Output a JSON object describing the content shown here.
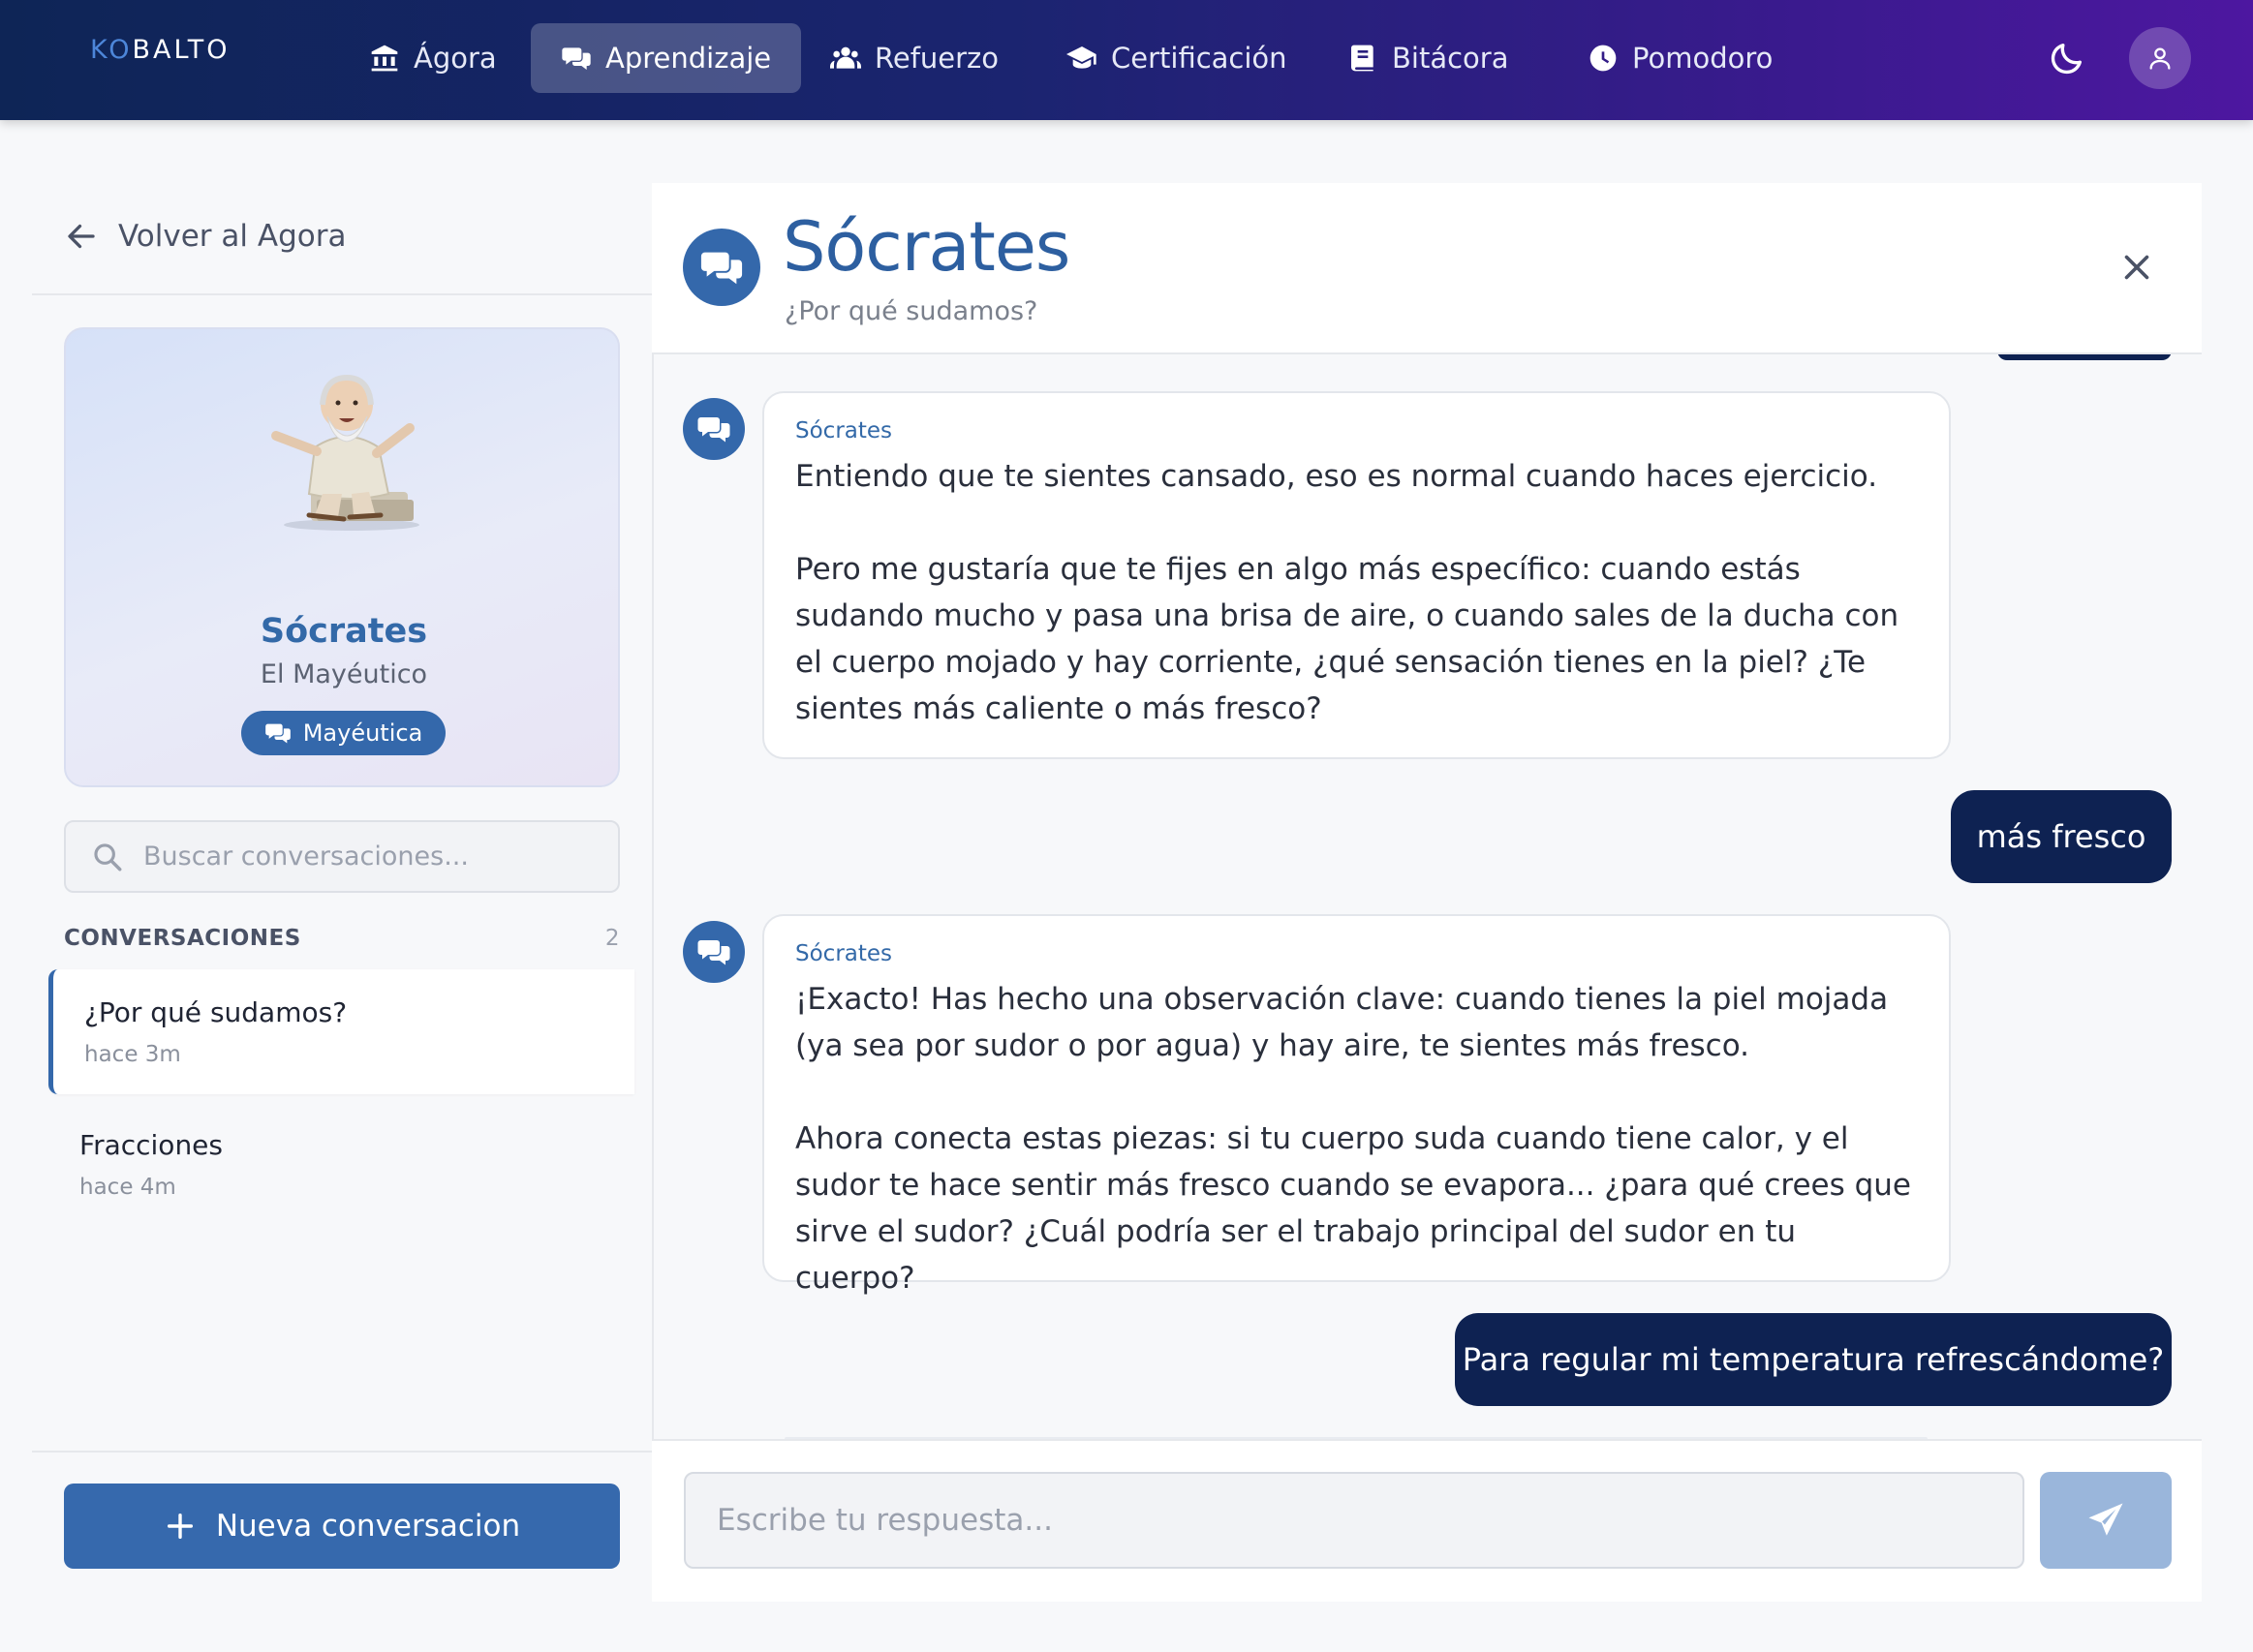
{
  "app": {
    "logo_text_a": "KO",
    "logo_text_b": "BALTO",
    "accent_color": "#3468ab",
    "nav_gradient": [
      "#0e2556",
      "#4d17a0"
    ]
  },
  "nav": {
    "items": [
      {
        "label": "Ágora",
        "icon": "bank-icon"
      },
      {
        "label": "Aprendizaje",
        "icon": "chat-bubbles-icon",
        "active": true
      },
      {
        "label": "Refuerzo",
        "icon": "users-icon"
      },
      {
        "label": "Certificación",
        "icon": "graduation-cap-icon"
      },
      {
        "label": "Bitácora",
        "icon": "book-icon"
      },
      {
        "label": "Pomodoro",
        "icon": "clock-icon"
      }
    ],
    "theme_toggle_icon": "moon-icon",
    "profile_icon": "user-icon"
  },
  "sidebar": {
    "back_label": "Volver al Agora",
    "persona": {
      "name": "Sócrates",
      "subtitle": "El Mayéutico",
      "badge": "Mayéutica"
    },
    "search": {
      "placeholder": "Buscar conversaciones..."
    },
    "conversations_header": "CONVERSACIONES",
    "conversations_count": "2",
    "conversations": [
      {
        "title": "¿Por qué sudamos?",
        "time": "hace 3m",
        "active": true
      },
      {
        "title": "Fracciones",
        "time": "hace 4m",
        "active": false
      }
    ],
    "new_conversation_label": "Nueva conversacion"
  },
  "chat": {
    "title": "Sócrates",
    "subtitle": "¿Por qué sudamos?",
    "messages": [
      {
        "role": "assistant",
        "sender": "Sócrates",
        "text": "Entiendo que te sientes cansado, eso es normal cuando haces ejercicio.\n\nPero me gustaría que te fijes en algo más específico: cuando estás sudando mucho y pasa una brisa de aire, o cuando sales de la ducha con el cuerpo mojado y hay corriente, ¿qué sensación tienes en la piel? ¿Te sientes más caliente o más fresco?"
      },
      {
        "role": "user",
        "text": "más fresco"
      },
      {
        "role": "assistant",
        "sender": "Sócrates",
        "text": "¡Exacto! Has hecho una observación clave: cuando tienes la piel mojada (ya sea por sudor o por agua) y hay aire, te sientes más fresco.\n\nAhora conecta estas piezas: si tu cuerpo suda cuando tiene calor, y el sudor te hace sentir más fresco cuando se evapora... ¿para qué crees que sirve el sudor? ¿Cuál podría ser el trabajo principal del sudor en tu cuerpo?"
      },
      {
        "role": "user",
        "text": "Para regular mi temperatura refrescándome?"
      }
    ],
    "reply_placeholder": "Escribe tu respuesta..."
  }
}
